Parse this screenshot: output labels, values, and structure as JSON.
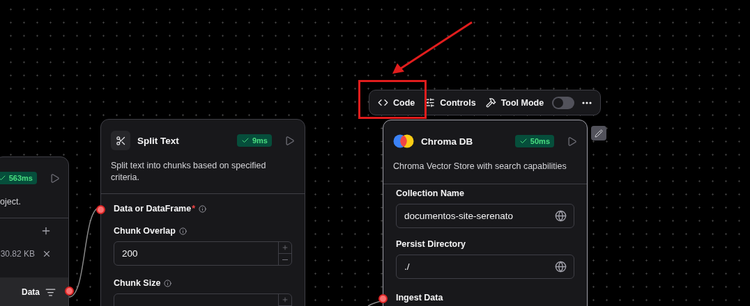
{
  "toolbar": {
    "items": [
      {
        "kind": "code",
        "label": "Code"
      },
      {
        "kind": "controls",
        "label": "Controls"
      },
      {
        "kind": "toggle",
        "label": "Tool Mode",
        "on": false
      },
      {
        "kind": "more"
      }
    ]
  },
  "left_node": {
    "badge": "563ms",
    "description": "oject.",
    "file_size": "30.82 KB",
    "output": "Data"
  },
  "split_node": {
    "title": "Split Text",
    "badge": "9ms",
    "description": "Split text into chunks based on specified criteria.",
    "fields": [
      {
        "kind": "handle",
        "label": "Data or DataFrame",
        "required_mark": "*"
      },
      {
        "kind": "number",
        "label": "Chunk Overlap",
        "value": "200"
      },
      {
        "kind": "number",
        "label": "Chunk Size"
      }
    ]
  },
  "chroma_node": {
    "title": "Chroma DB",
    "badge": "50ms",
    "description": "Chroma Vector Store with search capabilities",
    "fields": [
      {
        "kind": "text",
        "label": "Collection Name",
        "value": "documentos-site-serenato"
      },
      {
        "kind": "text",
        "label": "Persist Directory",
        "value": "./"
      },
      {
        "kind": "handle",
        "label": "Ingest Data"
      }
    ]
  }
}
